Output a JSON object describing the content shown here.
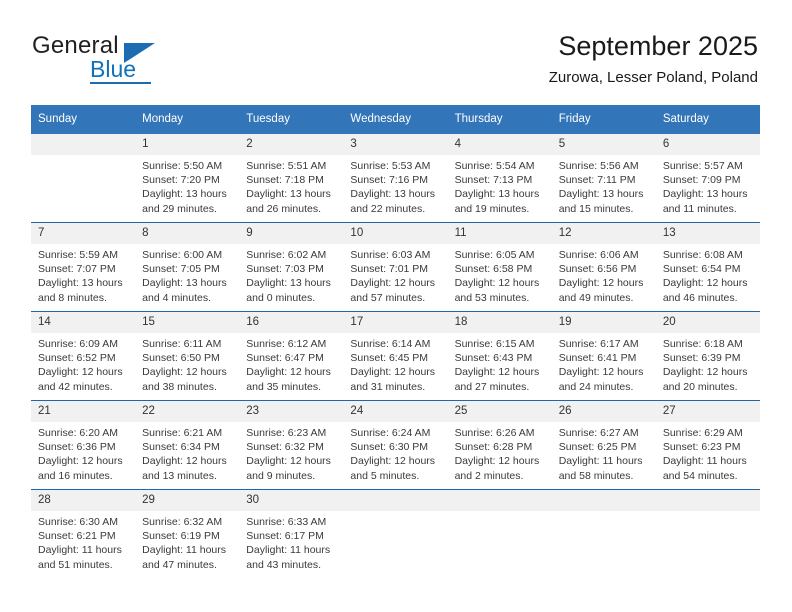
{
  "logo": {
    "word_one": "General",
    "word_two": "Blue",
    "triangle_icon": "triangle-icon",
    "brand_color": "#1b6cb0"
  },
  "header": {
    "title": "September 2025",
    "location": "Zurowa, Lesser Poland, Poland"
  },
  "calendar": {
    "header_bg": "#3275b9",
    "daynum_bg": "#f1f1f1",
    "row_divider_color": "#1f68a8",
    "weekday_labels": [
      "Sunday",
      "Monday",
      "Tuesday",
      "Wednesday",
      "Thursday",
      "Friday",
      "Saturday"
    ],
    "weeks": [
      [
        {
          "day": "",
          "empty": true,
          "sunrise": "",
          "sunset": "",
          "daylight_line1": "",
          "daylight_line2": ""
        },
        {
          "day": "1",
          "empty": false,
          "sunrise": "Sunrise: 5:50 AM",
          "sunset": "Sunset: 7:20 PM",
          "daylight_line1": "Daylight: 13 hours",
          "daylight_line2": "and 29 minutes."
        },
        {
          "day": "2",
          "empty": false,
          "sunrise": "Sunrise: 5:51 AM",
          "sunset": "Sunset: 7:18 PM",
          "daylight_line1": "Daylight: 13 hours",
          "daylight_line2": "and 26 minutes."
        },
        {
          "day": "3",
          "empty": false,
          "sunrise": "Sunrise: 5:53 AM",
          "sunset": "Sunset: 7:16 PM",
          "daylight_line1": "Daylight: 13 hours",
          "daylight_line2": "and 22 minutes."
        },
        {
          "day": "4",
          "empty": false,
          "sunrise": "Sunrise: 5:54 AM",
          "sunset": "Sunset: 7:13 PM",
          "daylight_line1": "Daylight: 13 hours",
          "daylight_line2": "and 19 minutes."
        },
        {
          "day": "5",
          "empty": false,
          "sunrise": "Sunrise: 5:56 AM",
          "sunset": "Sunset: 7:11 PM",
          "daylight_line1": "Daylight: 13 hours",
          "daylight_line2": "and 15 minutes."
        },
        {
          "day": "6",
          "empty": false,
          "sunrise": "Sunrise: 5:57 AM",
          "sunset": "Sunset: 7:09 PM",
          "daylight_line1": "Daylight: 13 hours",
          "daylight_line2": "and 11 minutes."
        }
      ],
      [
        {
          "day": "7",
          "empty": false,
          "sunrise": "Sunrise: 5:59 AM",
          "sunset": "Sunset: 7:07 PM",
          "daylight_line1": "Daylight: 13 hours",
          "daylight_line2": "and 8 minutes."
        },
        {
          "day": "8",
          "empty": false,
          "sunrise": "Sunrise: 6:00 AM",
          "sunset": "Sunset: 7:05 PM",
          "daylight_line1": "Daylight: 13 hours",
          "daylight_line2": "and 4 minutes."
        },
        {
          "day": "9",
          "empty": false,
          "sunrise": "Sunrise: 6:02 AM",
          "sunset": "Sunset: 7:03 PM",
          "daylight_line1": "Daylight: 13 hours",
          "daylight_line2": "and 0 minutes."
        },
        {
          "day": "10",
          "empty": false,
          "sunrise": "Sunrise: 6:03 AM",
          "sunset": "Sunset: 7:01 PM",
          "daylight_line1": "Daylight: 12 hours",
          "daylight_line2": "and 57 minutes."
        },
        {
          "day": "11",
          "empty": false,
          "sunrise": "Sunrise: 6:05 AM",
          "sunset": "Sunset: 6:58 PM",
          "daylight_line1": "Daylight: 12 hours",
          "daylight_line2": "and 53 minutes."
        },
        {
          "day": "12",
          "empty": false,
          "sunrise": "Sunrise: 6:06 AM",
          "sunset": "Sunset: 6:56 PM",
          "daylight_line1": "Daylight: 12 hours",
          "daylight_line2": "and 49 minutes."
        },
        {
          "day": "13",
          "empty": false,
          "sunrise": "Sunrise: 6:08 AM",
          "sunset": "Sunset: 6:54 PM",
          "daylight_line1": "Daylight: 12 hours",
          "daylight_line2": "and 46 minutes."
        }
      ],
      [
        {
          "day": "14",
          "empty": false,
          "sunrise": "Sunrise: 6:09 AM",
          "sunset": "Sunset: 6:52 PM",
          "daylight_line1": "Daylight: 12 hours",
          "daylight_line2": "and 42 minutes."
        },
        {
          "day": "15",
          "empty": false,
          "sunrise": "Sunrise: 6:11 AM",
          "sunset": "Sunset: 6:50 PM",
          "daylight_line1": "Daylight: 12 hours",
          "daylight_line2": "and 38 minutes."
        },
        {
          "day": "16",
          "empty": false,
          "sunrise": "Sunrise: 6:12 AM",
          "sunset": "Sunset: 6:47 PM",
          "daylight_line1": "Daylight: 12 hours",
          "daylight_line2": "and 35 minutes."
        },
        {
          "day": "17",
          "empty": false,
          "sunrise": "Sunrise: 6:14 AM",
          "sunset": "Sunset: 6:45 PM",
          "daylight_line1": "Daylight: 12 hours",
          "daylight_line2": "and 31 minutes."
        },
        {
          "day": "18",
          "empty": false,
          "sunrise": "Sunrise: 6:15 AM",
          "sunset": "Sunset: 6:43 PM",
          "daylight_line1": "Daylight: 12 hours",
          "daylight_line2": "and 27 minutes."
        },
        {
          "day": "19",
          "empty": false,
          "sunrise": "Sunrise: 6:17 AM",
          "sunset": "Sunset: 6:41 PM",
          "daylight_line1": "Daylight: 12 hours",
          "daylight_line2": "and 24 minutes."
        },
        {
          "day": "20",
          "empty": false,
          "sunrise": "Sunrise: 6:18 AM",
          "sunset": "Sunset: 6:39 PM",
          "daylight_line1": "Daylight: 12 hours",
          "daylight_line2": "and 20 minutes."
        }
      ],
      [
        {
          "day": "21",
          "empty": false,
          "sunrise": "Sunrise: 6:20 AM",
          "sunset": "Sunset: 6:36 PM",
          "daylight_line1": "Daylight: 12 hours",
          "daylight_line2": "and 16 minutes."
        },
        {
          "day": "22",
          "empty": false,
          "sunrise": "Sunrise: 6:21 AM",
          "sunset": "Sunset: 6:34 PM",
          "daylight_line1": "Daylight: 12 hours",
          "daylight_line2": "and 13 minutes."
        },
        {
          "day": "23",
          "empty": false,
          "sunrise": "Sunrise: 6:23 AM",
          "sunset": "Sunset: 6:32 PM",
          "daylight_line1": "Daylight: 12 hours",
          "daylight_line2": "and 9 minutes."
        },
        {
          "day": "24",
          "empty": false,
          "sunrise": "Sunrise: 6:24 AM",
          "sunset": "Sunset: 6:30 PM",
          "daylight_line1": "Daylight: 12 hours",
          "daylight_line2": "and 5 minutes."
        },
        {
          "day": "25",
          "empty": false,
          "sunrise": "Sunrise: 6:26 AM",
          "sunset": "Sunset: 6:28 PM",
          "daylight_line1": "Daylight: 12 hours",
          "daylight_line2": "and 2 minutes."
        },
        {
          "day": "26",
          "empty": false,
          "sunrise": "Sunrise: 6:27 AM",
          "sunset": "Sunset: 6:25 PM",
          "daylight_line1": "Daylight: 11 hours",
          "daylight_line2": "and 58 minutes."
        },
        {
          "day": "27",
          "empty": false,
          "sunrise": "Sunrise: 6:29 AM",
          "sunset": "Sunset: 6:23 PM",
          "daylight_line1": "Daylight: 11 hours",
          "daylight_line2": "and 54 minutes."
        }
      ],
      [
        {
          "day": "28",
          "empty": false,
          "sunrise": "Sunrise: 6:30 AM",
          "sunset": "Sunset: 6:21 PM",
          "daylight_line1": "Daylight: 11 hours",
          "daylight_line2": "and 51 minutes."
        },
        {
          "day": "29",
          "empty": false,
          "sunrise": "Sunrise: 6:32 AM",
          "sunset": "Sunset: 6:19 PM",
          "daylight_line1": "Daylight: 11 hours",
          "daylight_line2": "and 47 minutes."
        },
        {
          "day": "30",
          "empty": false,
          "sunrise": "Sunrise: 6:33 AM",
          "sunset": "Sunset: 6:17 PM",
          "daylight_line1": "Daylight: 11 hours",
          "daylight_line2": "and 43 minutes."
        },
        {
          "day": "",
          "empty": true,
          "sunrise": "",
          "sunset": "",
          "daylight_line1": "",
          "daylight_line2": ""
        },
        {
          "day": "",
          "empty": true,
          "sunrise": "",
          "sunset": "",
          "daylight_line1": "",
          "daylight_line2": ""
        },
        {
          "day": "",
          "empty": true,
          "sunrise": "",
          "sunset": "",
          "daylight_line1": "",
          "daylight_line2": ""
        },
        {
          "day": "",
          "empty": true,
          "sunrise": "",
          "sunset": "",
          "daylight_line1": "",
          "daylight_line2": ""
        }
      ]
    ]
  }
}
